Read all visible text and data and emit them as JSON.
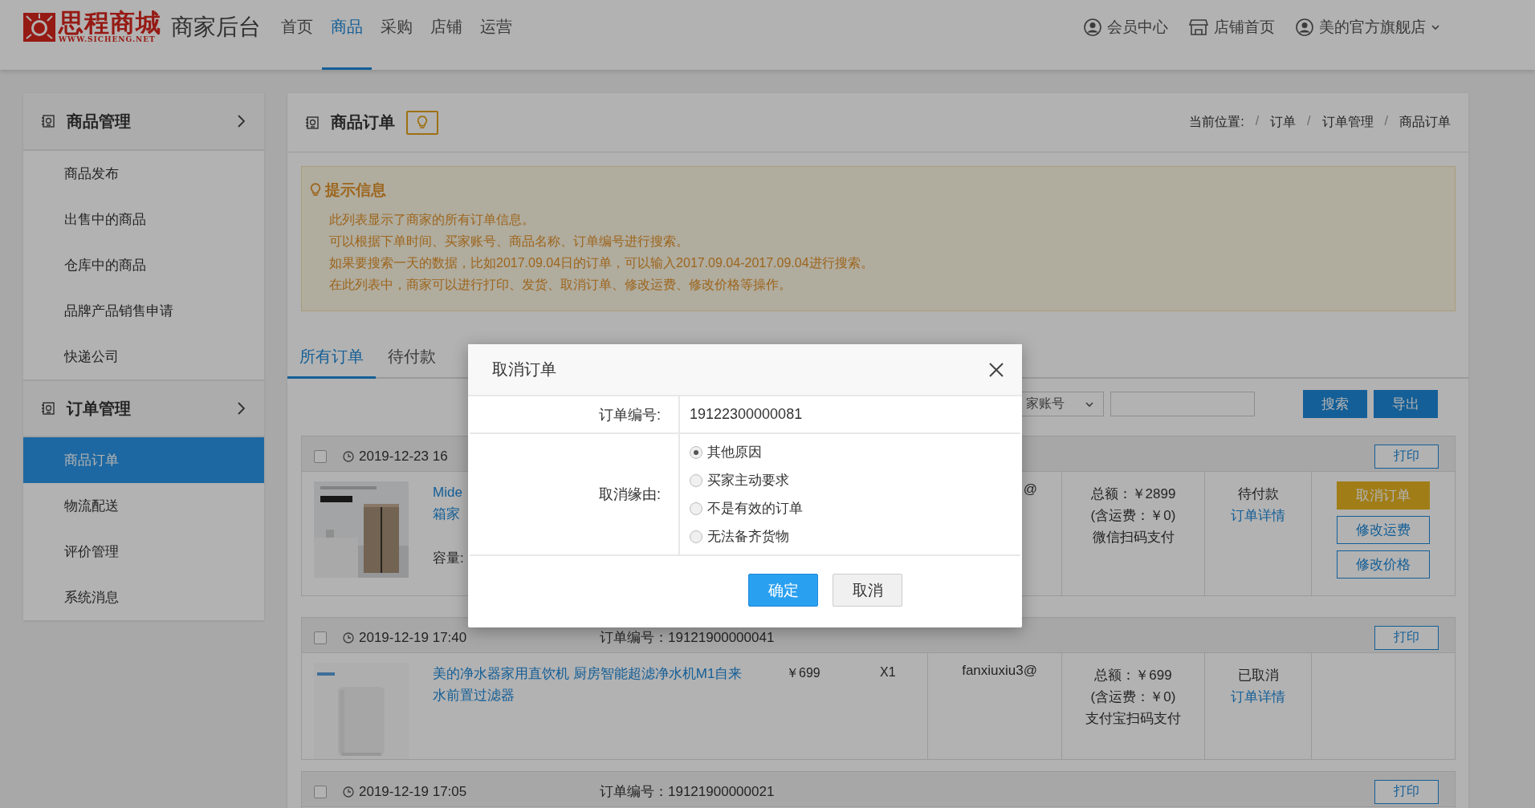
{
  "header": {
    "logo": {
      "name": "思程商城",
      "url": "WWW.SICHENG.NET"
    },
    "title": "商家后台",
    "nav": [
      {
        "label": "首页",
        "selected": false
      },
      {
        "label": "商品",
        "selected": true
      },
      {
        "label": "采购",
        "selected": false
      },
      {
        "label": "店铺",
        "selected": false
      },
      {
        "label": "运营",
        "selected": false
      }
    ],
    "links": [
      {
        "kind": "user",
        "label": "会员中心"
      },
      {
        "kind": "shop",
        "label": "店铺首页"
      },
      {
        "kind": "account",
        "label": "美的官方旗舰店"
      }
    ]
  },
  "sidebar": {
    "groups": [
      {
        "title": "商品管理",
        "items": [
          {
            "label": "商品发布",
            "selected": false
          },
          {
            "label": "出售中的商品",
            "selected": false
          },
          {
            "label": "仓库中的商品",
            "selected": false
          },
          {
            "label": "品牌产品销售申请",
            "selected": false
          },
          {
            "label": "快递公司",
            "selected": false
          }
        ]
      },
      {
        "title": "订单管理",
        "items": [
          {
            "label": "商品订单",
            "selected": true
          },
          {
            "label": "物流配送",
            "selected": false
          },
          {
            "label": "评价管理",
            "selected": false
          },
          {
            "label": "系统消息",
            "selected": false
          }
        ]
      }
    ]
  },
  "panel": {
    "title": "商品订单",
    "breadcrumb": {
      "label": "当前位置:",
      "separator": "/",
      "items": [
        "订单",
        "订单管理",
        "商品订单"
      ]
    },
    "hint": {
      "title": "提示信息",
      "lines": [
        "此列表显示了商家的所有订单信息。",
        "可以根据下单时间、买家账号、商品名称、订单编号进行搜索。",
        "如果要搜索一天的数据，比如2017.09.04日的订单，可以输入2017.09.04-2017.09.04进行搜索。",
        "在此列表中，商家可以进行打印、发货、取消订单、修改运费、修改价格等操作。"
      ]
    },
    "tabs": [
      {
        "label": "所有订单",
        "selected": true
      },
      {
        "label": "待付款",
        "selected": false
      }
    ],
    "search": {
      "select": "家账号",
      "buttons": [
        "搜索",
        "导出"
      ]
    },
    "orders": [
      {
        "checked": false,
        "date": "2019-12-23 16",
        "print": "打印",
        "product": {
          "lines": [
            "Mide",
            "箱家"
          ],
          "spec": "容量:"
        },
        "buyer": "@",
        "total": "总额：￥2899",
        "freight": "(含运费：￥0)",
        "payment": "微信扫码支付",
        "status": "待付款",
        "detail": "订单详情",
        "actions": [
          {
            "label": "取消订单",
            "kind": "primary"
          },
          {
            "label": "修改运费",
            "kind": "outline"
          },
          {
            "label": "修改价格",
            "kind": "outline"
          }
        ]
      },
      {
        "checked": false,
        "date": "2019-12-19 17:40",
        "number": "订单编号：19121900000041",
        "print": "打印",
        "product": {
          "name": "美的净水器家用直饮机 厨房智能超滤净水机M1自来水前置过滤器",
          "price": "￥699",
          "qty": "X1"
        },
        "buyer": "fanxiuxiu3@",
        "total": "总额：￥699",
        "freight": "(含运费：￥0)",
        "payment": "支付宝扫码支付",
        "status": "已取消",
        "detail": "订单详情"
      },
      {
        "checked": false,
        "date": "2019-12-19 17:05",
        "number": "订单编号：19121900000021",
        "print": "打印"
      }
    ]
  },
  "dialog": {
    "title": "取消订单",
    "fields": [
      {
        "label": "订单编号:",
        "value": "19122300000081"
      }
    ],
    "reason": {
      "label": "取消缘由:",
      "options": [
        {
          "label": "其他原因",
          "selected": true
        },
        {
          "label": "买家主动要求",
          "selected": false
        },
        {
          "label": "不是有效的订单",
          "selected": false
        },
        {
          "label": "无法备齐货物",
          "selected": false
        }
      ]
    },
    "buttons": [
      {
        "label": "确定",
        "kind": "primary"
      },
      {
        "label": "取消",
        "kind": "default"
      }
    ]
  }
}
